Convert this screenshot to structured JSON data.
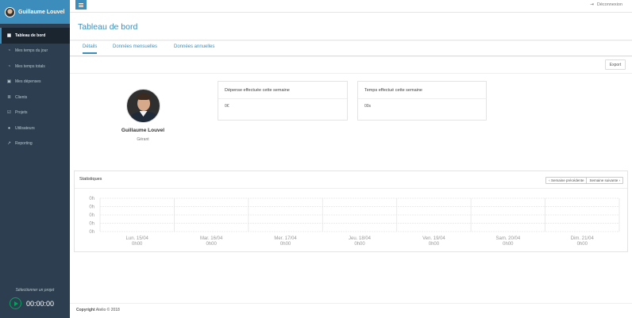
{
  "sidebar": {
    "user_name": "Guillaume Louvel",
    "items": [
      {
        "icon": "dashboard-icon",
        "glyph": "▦",
        "label": "Tableau de bord",
        "active": true
      },
      {
        "icon": "clock-icon",
        "glyph": "◔",
        "label": "Mes temps du jour",
        "active": false
      },
      {
        "icon": "clock-icon",
        "glyph": "◔",
        "label": "Mes temps totals",
        "active": false
      },
      {
        "icon": "money-icon",
        "glyph": "▣",
        "label": "Mes dépenses",
        "active": false
      },
      {
        "icon": "list-icon",
        "glyph": "≣",
        "label": "Clients",
        "active": false
      },
      {
        "icon": "check-square-icon",
        "glyph": "☑",
        "label": "Projets",
        "active": false
      },
      {
        "icon": "users-icon",
        "glyph": "●",
        "label": "Utilisateurs",
        "active": false
      },
      {
        "icon": "line-chart-icon",
        "glyph": "↗",
        "label": "Reporting",
        "active": false
      }
    ],
    "project_select": "Sélectionner un projet",
    "timer": "00:00:00"
  },
  "topbar": {
    "logout_label": "Déconnexion"
  },
  "page": {
    "title": "Tableau de bord",
    "tabs": [
      "Détails",
      "Données mensuelles",
      "Données annuelles"
    ]
  },
  "content": {
    "export_label": "Export",
    "profile": {
      "name": "Guillaume Louvel",
      "role": "Gérant"
    },
    "stat_boxes": [
      {
        "title": "Dépense effectuée cette semaine",
        "value": "0€"
      },
      {
        "title": "Temps effectué cette semaine",
        "value": "00s"
      }
    ]
  },
  "statistics": {
    "title": "Statistiques",
    "prev_label": "Semaine précédente",
    "next_label": "Semaine suivante"
  },
  "chart_data": {
    "type": "bar",
    "categories": [
      "Lun. 15/04",
      "Mar. 16/04",
      "Mer. 17/04",
      "Jeu. 18/04",
      "Ven. 19/04",
      "Sam. 20/04",
      "Dim. 21/04"
    ],
    "category_totals": [
      "0h00",
      "0h00",
      "0h00",
      "0h00",
      "0h00",
      "0h00",
      "0h00"
    ],
    "values": [
      0,
      0,
      0,
      0,
      0,
      0,
      0
    ],
    "y_ticks": [
      "0h",
      "0h",
      "0h",
      "0h",
      "0h"
    ],
    "grid": true
  },
  "footer": {
    "copyright_strong": "Copyright",
    "copyright_text": "Atelio © 2018"
  }
}
